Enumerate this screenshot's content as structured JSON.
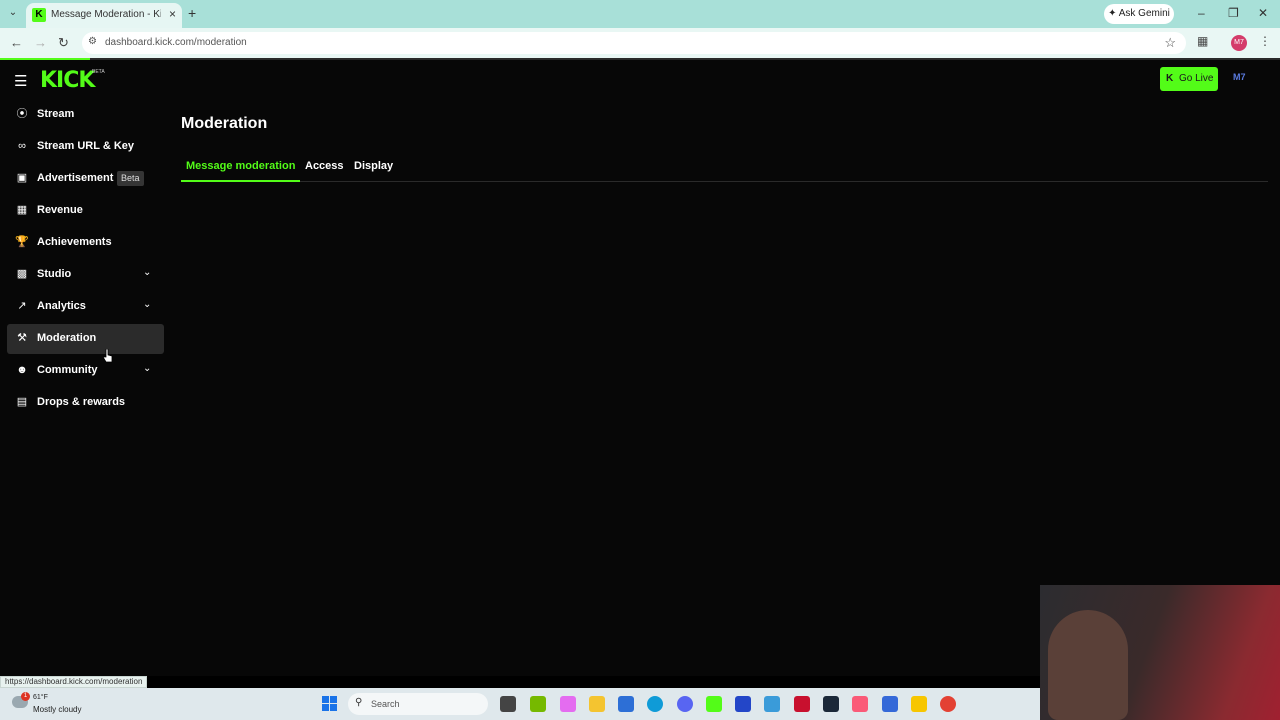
{
  "browser": {
    "tab_title": "Message Moderation - Kick Da",
    "tab_favicon": "K",
    "gemini_label": "Ask Gemini",
    "url": "dashboard.kick.com/moderation",
    "profile_initials": "M7",
    "status_url": "https://dashboard.kick.com/moderation"
  },
  "app": {
    "logo": "KICK",
    "logo_beta": "BETA",
    "go_live": "Go Live",
    "user_avatar": "M7"
  },
  "sidebar": {
    "items": [
      {
        "label": "Stream",
        "icon": "stream-icon"
      },
      {
        "label": "Stream URL & Key",
        "icon": "link-icon"
      },
      {
        "label": "Advertisement",
        "icon": "ad-icon",
        "badge": "Beta"
      },
      {
        "label": "Revenue",
        "icon": "revenue-icon"
      },
      {
        "label": "Achievements",
        "icon": "trophy-icon"
      },
      {
        "label": "Studio",
        "icon": "studio-icon",
        "expandable": true
      },
      {
        "label": "Analytics",
        "icon": "analytics-icon",
        "expandable": true
      },
      {
        "label": "Moderation",
        "icon": "wrench-icon",
        "active": true
      },
      {
        "label": "Community",
        "icon": "community-icon",
        "expandable": true
      },
      {
        "label": "Drops & rewards",
        "icon": "drops-icon"
      }
    ]
  },
  "main": {
    "title": "Moderation",
    "tabs": [
      {
        "label": "Message moderation",
        "active": true
      },
      {
        "label": "Access"
      },
      {
        "label": "Display"
      }
    ]
  },
  "taskbar": {
    "temperature": "61°F",
    "weather": "Mostly cloudy",
    "weather_badge": "1",
    "search_placeholder": "Search"
  },
  "colors": {
    "accent": "#53fc18",
    "background": "#070707",
    "active_item": "#2b2b2b"
  }
}
